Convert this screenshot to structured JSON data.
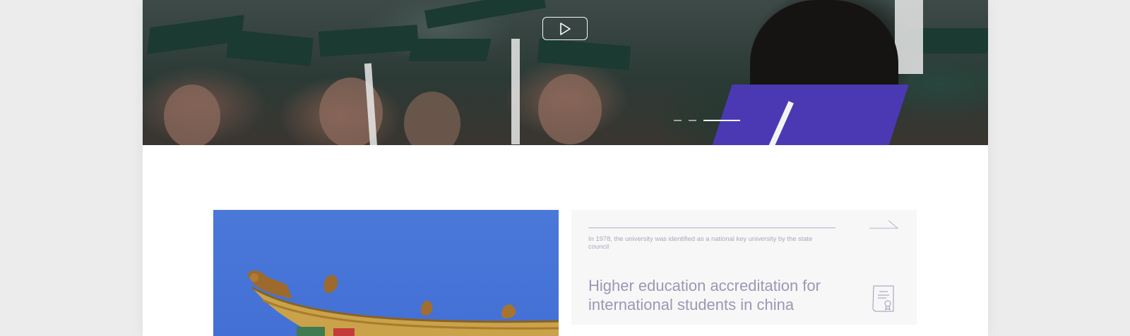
{
  "hero": {
    "play_label": "Play video",
    "slides": [
      {
        "active": false
      },
      {
        "active": false
      },
      {
        "active": true
      }
    ]
  },
  "feature_card": {
    "note": "In 1978, the university was identified as a national key university by the state council",
    "title": "Higher education accreditation for international students in china",
    "next_icon": "arrow-right-icon",
    "badge_icon": "certificate-icon"
  },
  "colors": {
    "page_bg": "#ececec",
    "card_bg": "#f7f7f8",
    "title_text": "#9b98b3",
    "accent_line": "#b3b1c9",
    "sky_blue": "#4470d6"
  }
}
